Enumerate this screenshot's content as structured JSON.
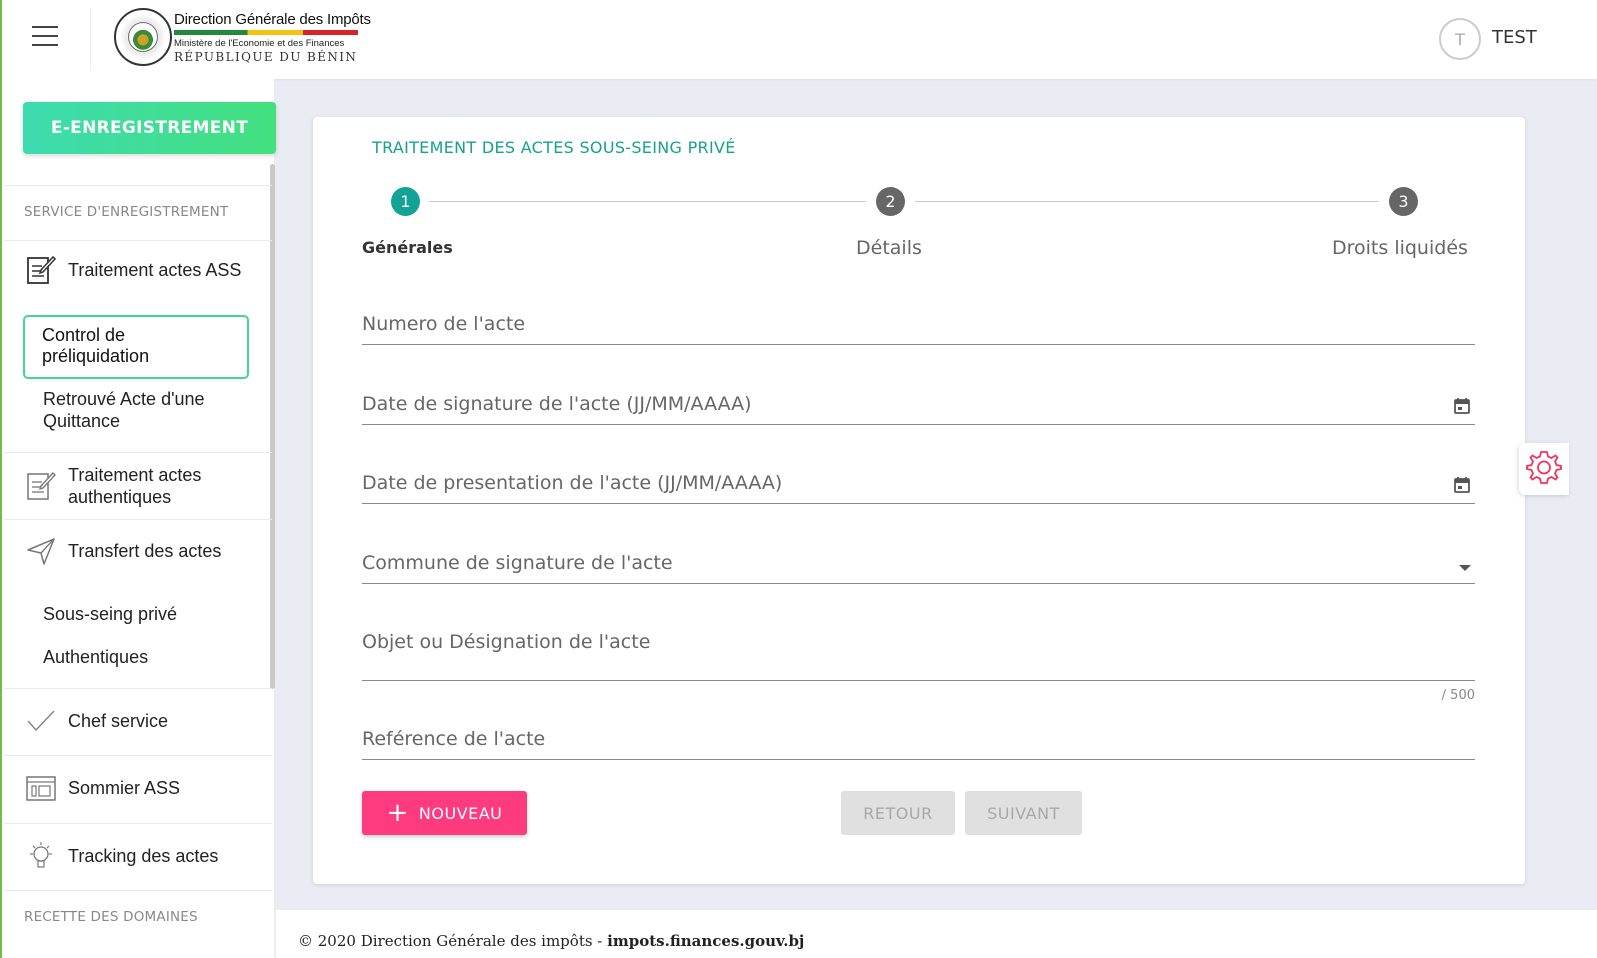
{
  "header": {
    "org_title": "Direction Générale des Impôts",
    "ministry": "Ministère de l'Economie et des Finances",
    "republic": "RÉPUBLIQUE DU BÉNIN",
    "avatar_initial": "T",
    "user_name": "TEST"
  },
  "sidebar": {
    "module_button": "E-ENREGISTREMENT",
    "section1": "SERVICE D'ENREGISTREMENT",
    "traitement_ass": "Traitement actes ASS",
    "control_preliquidation": "Control de préliquidation",
    "retrouve_acte": "Retrouvé Acte d'une Quittance",
    "traitement_auth": "Traitement actes authentiques",
    "transfert": "Transfert des actes",
    "sous_seing": "Sous-seing privé",
    "authentiques": "Authentiques",
    "chef_service": "Chef service",
    "sommier": "Sommier ASS",
    "tracking": "Tracking des actes",
    "section2": "RECETTE DES DOMAINES"
  },
  "form": {
    "title": "TRAITEMENT DES ACTES SOUS-SEING PRIVÉ",
    "steps": [
      {
        "num": "1",
        "label": "Générales",
        "active": true
      },
      {
        "num": "2",
        "label": "Détails",
        "active": false
      },
      {
        "num": "3",
        "label": "Droits liquidés",
        "active": false
      }
    ],
    "fields": {
      "numero": "Numero de l'acte",
      "date_signature": "Date de signature de l'acte (JJ/MM/AAAA)",
      "date_presentation": "Date de presentation de l'acte (JJ/MM/AAAA)",
      "commune": "Commune de signature de l'acte",
      "objet": "Objet ou Désignation de l'acte",
      "objet_counter": "/ 500",
      "reference": "Reférence de l'acte"
    },
    "buttons": {
      "nouveau": "NOUVEAU",
      "retour": "RETOUR",
      "suivant": "SUIVANT"
    }
  },
  "footer": {
    "copyright": "© 2020 Direction Générale des impôts -",
    "site": "impots.finances.gouv.bj"
  },
  "colors": {
    "accent_teal": "#15a38a",
    "step_active": "#12a396",
    "step_inactive": "#666666",
    "button_pink": "#ff3b7f",
    "sidebar_green": "#3fd989"
  }
}
